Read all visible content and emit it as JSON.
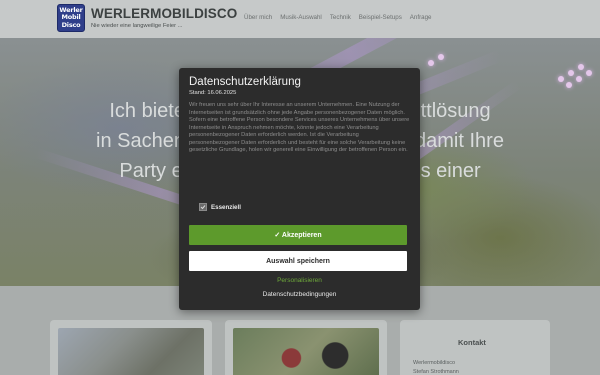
{
  "header": {
    "logo_lines": [
      "Werler",
      "Mobil",
      "Disco"
    ],
    "title": "WERLERMOBILDISCO",
    "tagline": "Nie wieder eine langweilige Feier ...",
    "nav": [
      "Über mich",
      "Musik-Auswahl",
      "Technik",
      "Beispiel-Setups",
      "Anfrage"
    ]
  },
  "hero": {
    "line1": "Ich biete sei                                plettlösung",
    "line2": "in Sachen D                                  k, damit Ihre",
    "line3": "Party ein                                    aus einer"
  },
  "sidebar": {
    "title": "Kontakt",
    "line1": "Werlermobildisco",
    "line2": "Stefan Strothmann"
  },
  "dialog": {
    "title": "Datenschutzerklärung",
    "date": "Stand: 16.06.2025",
    "body": "Wir freuen uns sehr über Ihr Interesse an unserem Unternehmen. Eine Nutzung der Internetseiten ist grundsätzlich ohne jede Angabe personenbezogener Daten möglich. Sofern eine betroffene Person besondere Services unseres Unternehmens über unsere Internetseite in Anspruch nehmen möchte, könnte jedoch eine Verarbeitung personenbezogener Daten erforderlich werden. Ist die Verarbeitung personenbezogener Daten erforderlich und besteht für eine solche Verarbeitung keine gesetzliche Grundlage, holen wir generell eine Einwilligung der betroffenen Person ein.",
    "checkbox_label": "Essenziell",
    "accept_label": "✓ Akzeptieren",
    "save_label": "Auswahl speichern",
    "personalize_label": "Personalisieren",
    "terms_label": "Datenschutzbedingungen"
  },
  "colors": {
    "accept": "#5d9a2c",
    "dialog_bg": "#2c2c2c",
    "link_green": "#6da63a"
  }
}
